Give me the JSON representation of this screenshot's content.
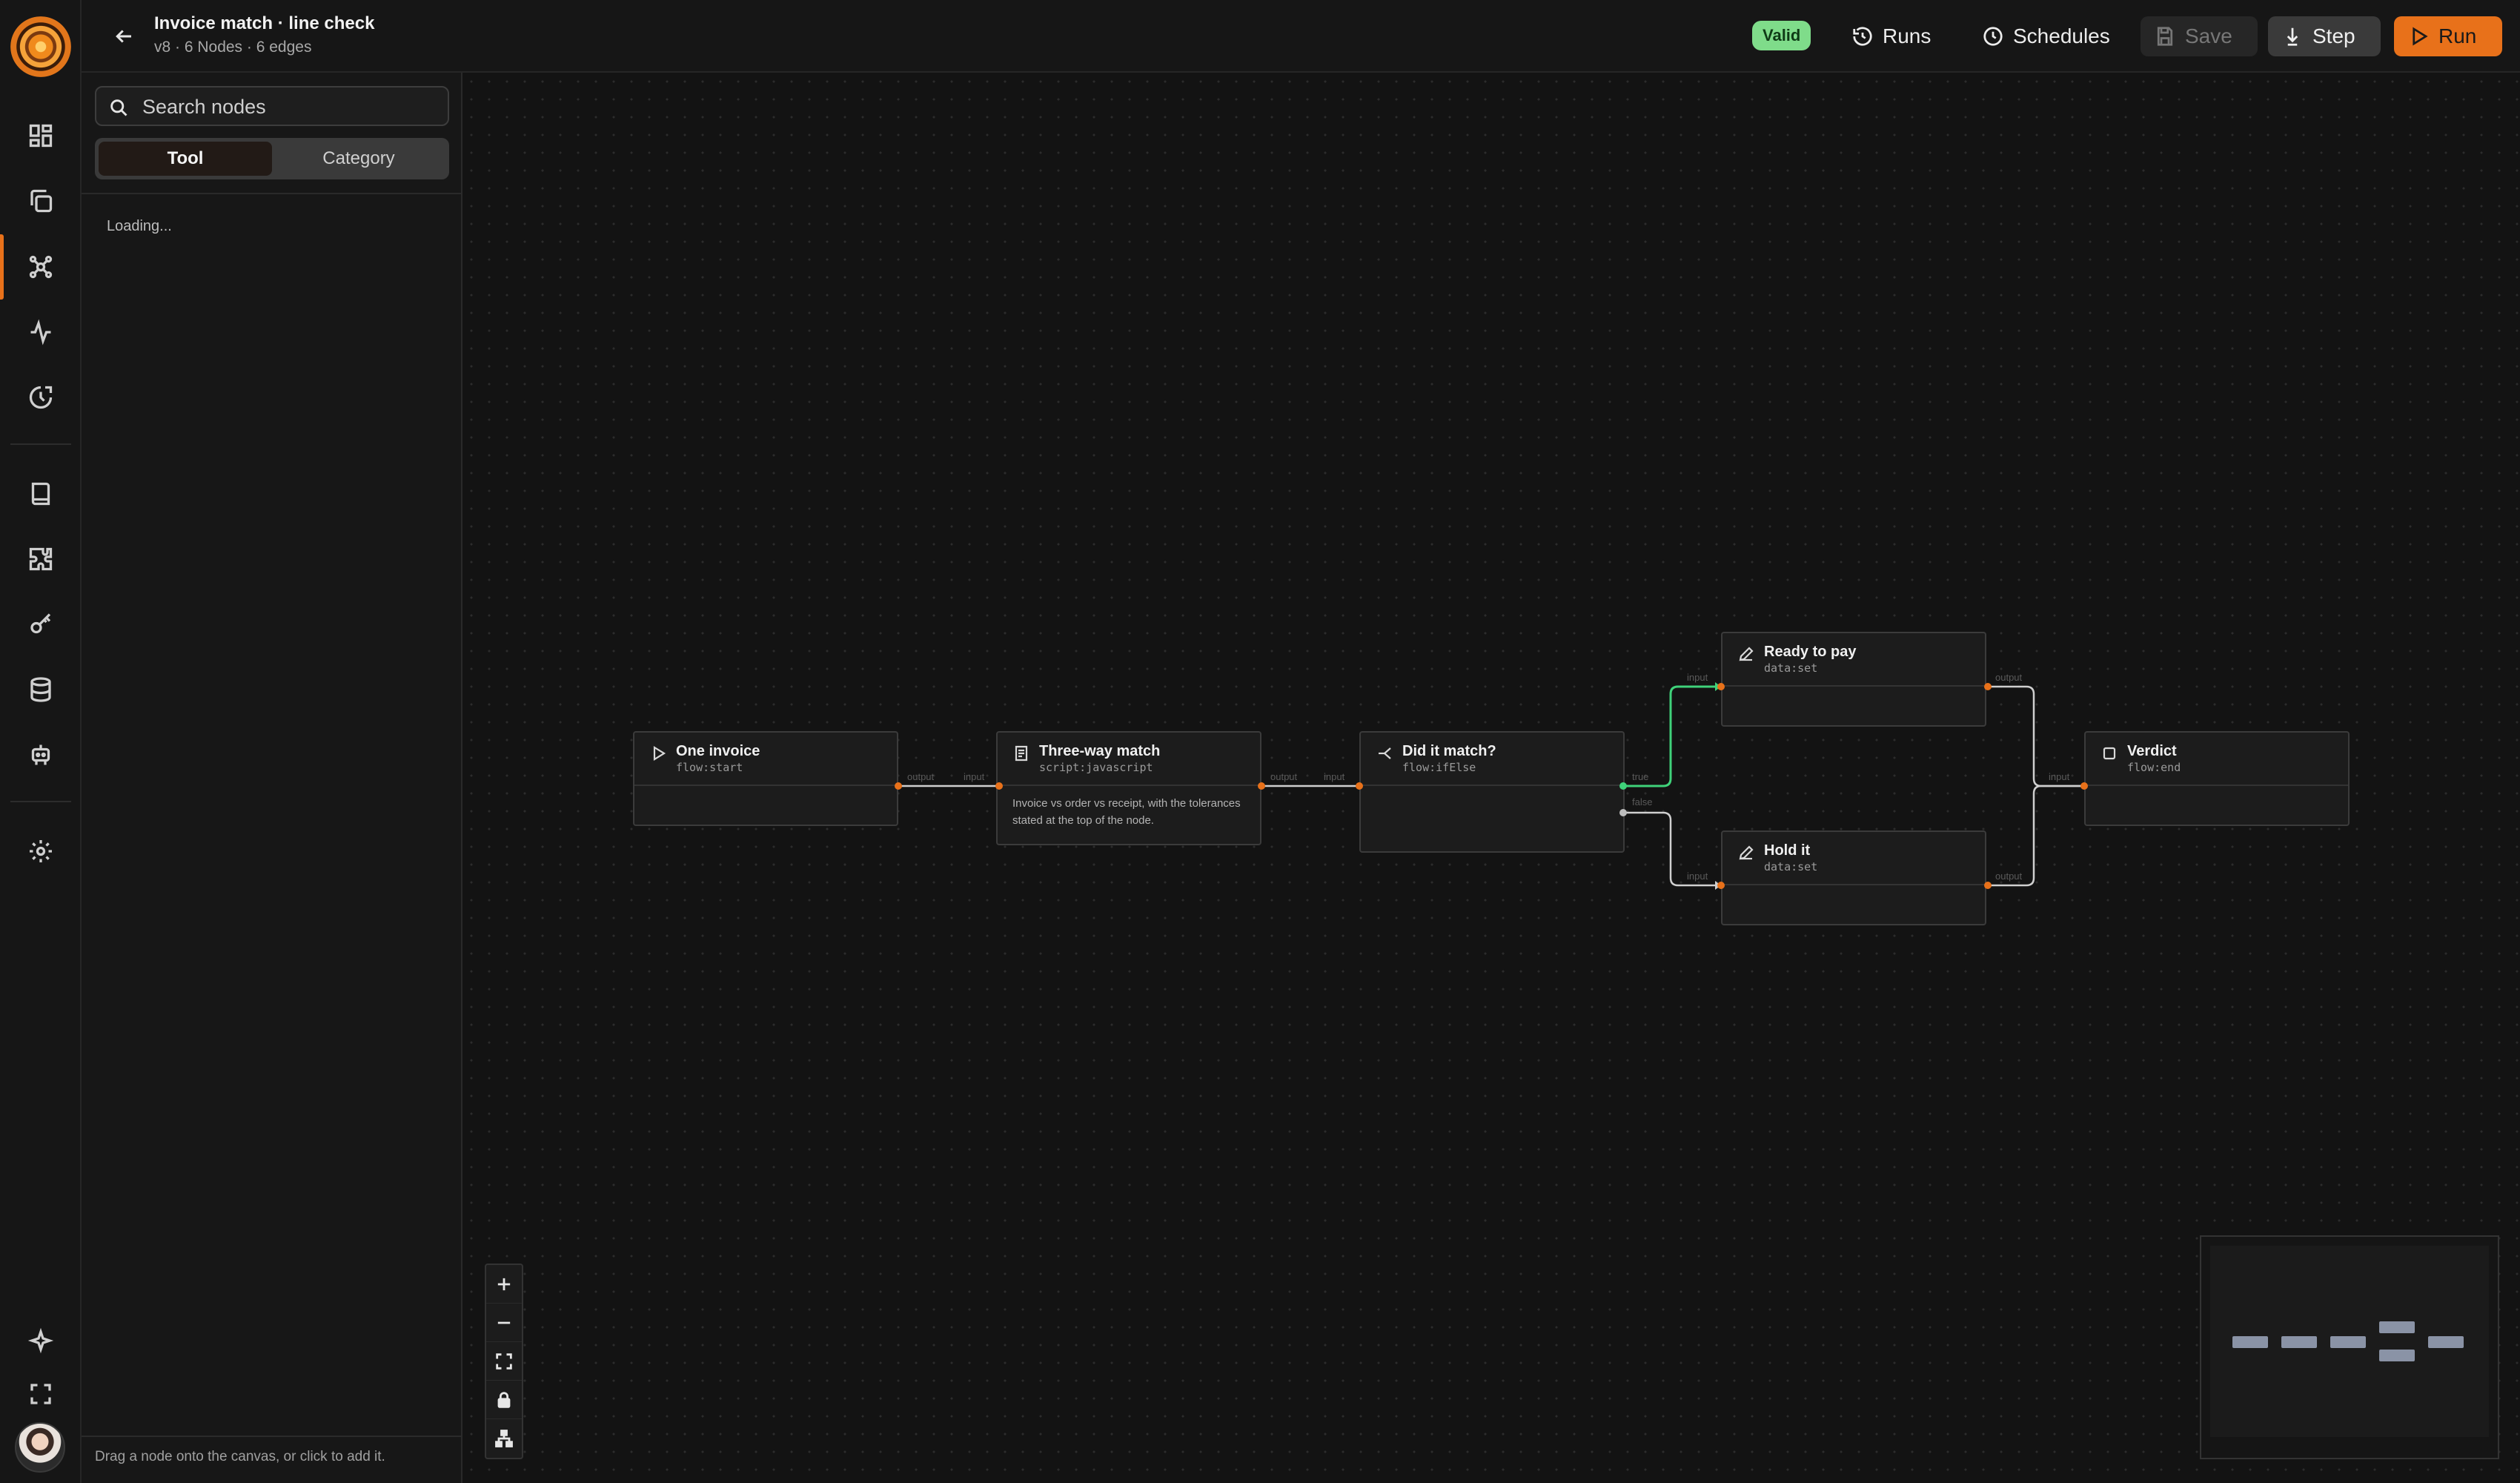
{
  "workflow": {
    "title": "Invoice match · line check",
    "subtitle": "v8 · 6 Nodes · 6 edges",
    "status": "Valid"
  },
  "toolbar": {
    "runs": "Runs",
    "schedules": "Schedules",
    "save": "Save",
    "step": "Step",
    "run": "Run"
  },
  "panel": {
    "search_placeholder": "Search nodes",
    "tab_tool": "Tool",
    "tab_category": "Category",
    "loading": "Loading...",
    "hint": "Drag a node onto the canvas, or click to add it."
  },
  "nodes": {
    "start": {
      "name": "One invoice",
      "type": "flow:start"
    },
    "match": {
      "name": "Three-way match",
      "type": "script:javascript",
      "description": "Invoice vs order vs receipt, with the tolerances stated at the top of the node."
    },
    "branch": {
      "name": "Did it match?",
      "type": "flow:ifElse"
    },
    "ready": {
      "name": "Ready to pay",
      "type": "data:set"
    },
    "hold": {
      "name": "Hold it",
      "type": "data:set"
    },
    "end": {
      "name": "Verdict",
      "type": "flow:end"
    }
  },
  "ports": {
    "output": "output",
    "input": "input",
    "true": "true",
    "false": "false"
  },
  "colors": {
    "accent": "#e8711a",
    "valid": "#7fdc8a",
    "true_edge": "#3fd27a",
    "edge": "#cfcfcf"
  }
}
